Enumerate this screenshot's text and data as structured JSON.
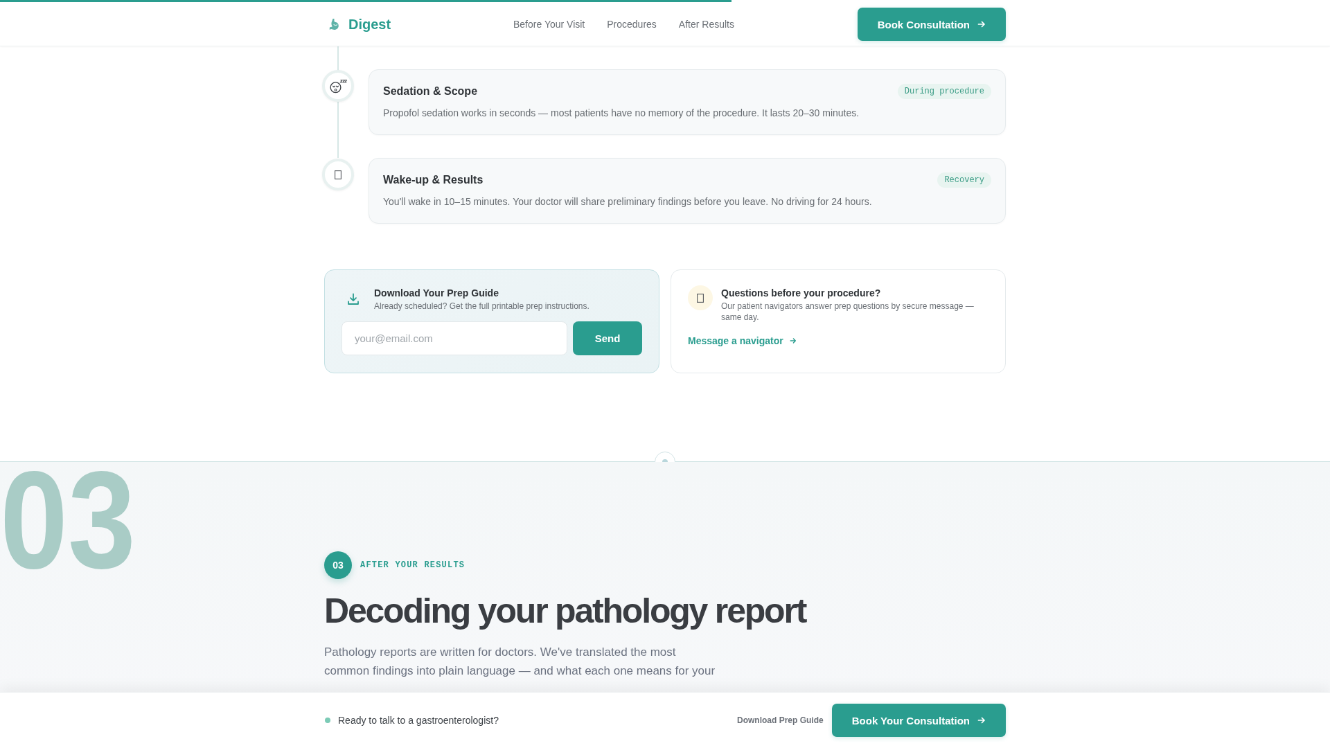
{
  "reading_progress": {
    "level": 0.55
  },
  "header": {
    "logo": "Digest",
    "nav": [
      {
        "label": "Before Your Visit"
      },
      {
        "label": "Procedures"
      },
      {
        "label": "After Results"
      }
    ],
    "cta": "Book Consultation"
  },
  "timeline": [
    {
      "kind": "sedation",
      "title": "Sedation & Scope",
      "badge": "During procedure",
      "description": "Propofol sedation works in seconds — most patients have no memory of the procedure. It lasts 20–30 minutes."
    },
    {
      "kind": "recovery",
      "title": "Wake-up & Results",
      "badge": "Recovery",
      "description": "You'll wake in 10–15 minutes. Your doctor will share preliminary findings before you leave. No driving for 24 hours."
    }
  ],
  "prep_guide": {
    "title": "Download Your Prep Guide",
    "subtitle": "Already scheduled? Get the full printable prep instructions.",
    "email": {
      "placeholder": "your@email.com"
    },
    "button": "Send"
  },
  "questions": {
    "title": "Questions before your procedure?",
    "description": "Our patient navigators answer prep questions by secure message — same day.",
    "link": "Message a navigator"
  },
  "section": {
    "watermark": "03",
    "number": "03",
    "eyebrow": "AFTER YOUR RESULTS",
    "heading": "Decoding your pathology report",
    "intro": "Pathology reports are written for doctors. We've translated the most common findings into plain language — and what each one means for your"
  },
  "bottom_bar": {
    "message": "Ready to talk to a gastroenterologist?",
    "link": "Download Prep Guide",
    "button": "Book Your Consultation"
  }
}
